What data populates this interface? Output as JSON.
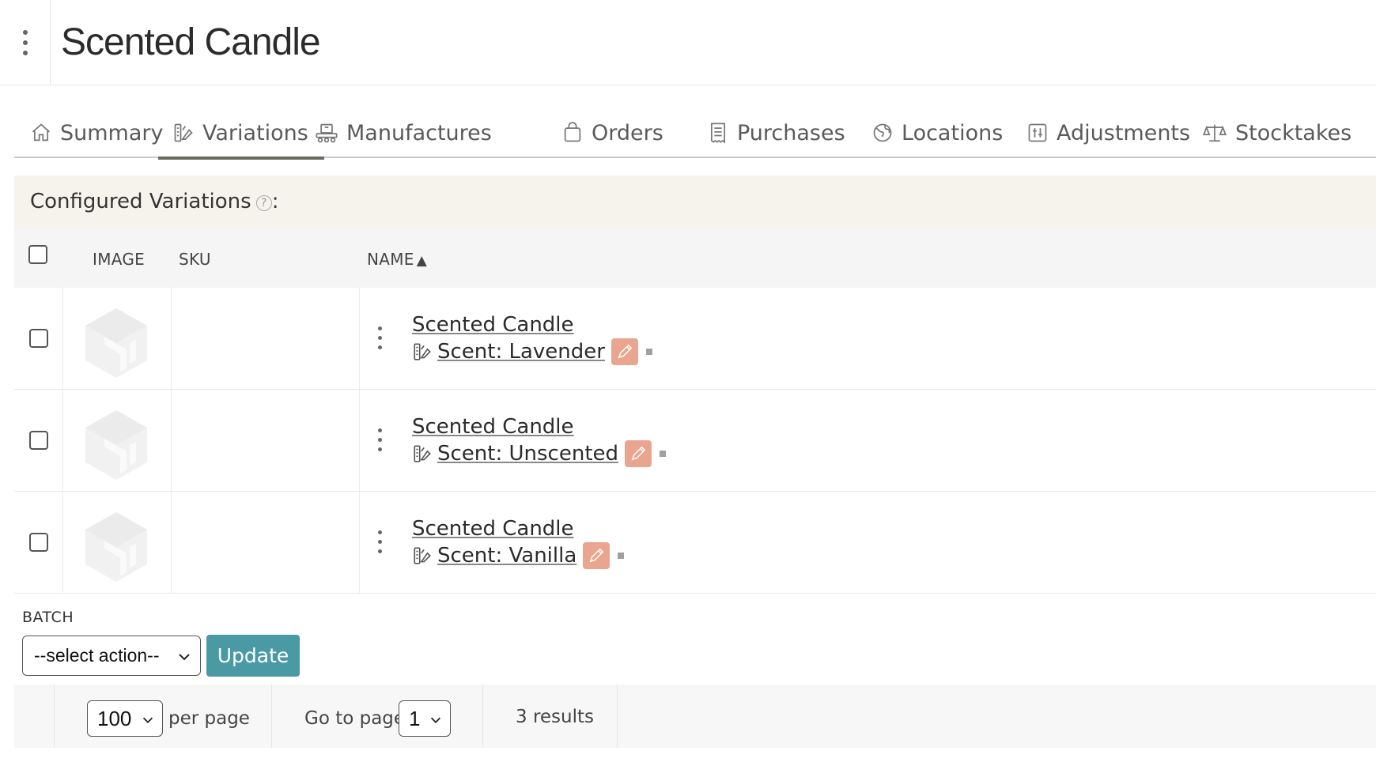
{
  "header": {
    "title": "Scented Candle"
  },
  "tabs": [
    {
      "label": "Summary",
      "icon": "home-icon"
    },
    {
      "label": "Variations",
      "icon": "variations-icon",
      "active": true
    },
    {
      "label": "Manufactures",
      "icon": "conveyor-icon"
    },
    {
      "label": "Orders",
      "icon": "shopping-bag-icon"
    },
    {
      "label": "Purchases",
      "icon": "receipt-icon"
    },
    {
      "label": "Locations",
      "icon": "globe-icon"
    },
    {
      "label": "Adjustments",
      "icon": "sliders-icon"
    },
    {
      "label": "Stocktakes",
      "icon": "scales-icon"
    }
  ],
  "variations_panel": {
    "title": "Configured Variations",
    "help_icon": "?",
    "colon": ":"
  },
  "table": {
    "columns": {
      "image": "IMAGE",
      "sku": "SKU",
      "name": "NAME",
      "sort_indicator": "▲"
    },
    "rows": [
      {
        "product": "Scented Candle",
        "variation": "Scent: Lavender",
        "sku": ""
      },
      {
        "product": "Scented Candle",
        "variation": "Scent: Unscented",
        "sku": ""
      },
      {
        "product": "Scented Candle",
        "variation": "Scent: Vanilla",
        "sku": ""
      }
    ]
  },
  "batch": {
    "label": "BATCH",
    "select_value": "--select action--",
    "update_label": "Update"
  },
  "pager": {
    "per_page_value": "100",
    "per_page_label": "per page",
    "goto_label": "Go to page",
    "page_value": "1",
    "results": "3 results"
  },
  "colors": {
    "accent": "#4a9aa5",
    "edit_button": "#e9a58f",
    "panel_bg": "#f6f3ec",
    "active_tab_underline": "#6b6b5e"
  }
}
